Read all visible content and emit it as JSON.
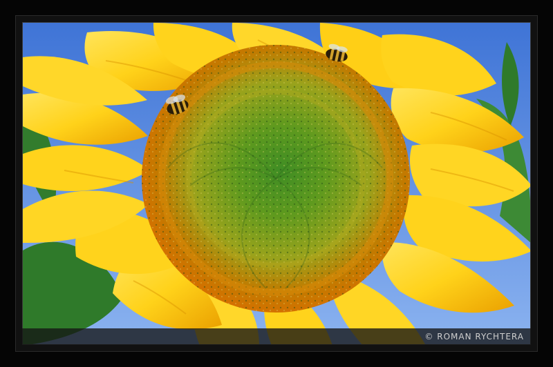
{
  "photo": {
    "subject": "sunflower",
    "colors": {
      "sky": "#4a7fd8",
      "petal": "#ffd21a",
      "petal_dark": "#f0a800",
      "disc_outer": "#c86f00",
      "disc_mid": "#8f9d1a",
      "disc_center": "#3a8a22",
      "leaf": "#2f7a2a"
    }
  },
  "credit": {
    "text": "© ROMAN RYCHTERA"
  }
}
